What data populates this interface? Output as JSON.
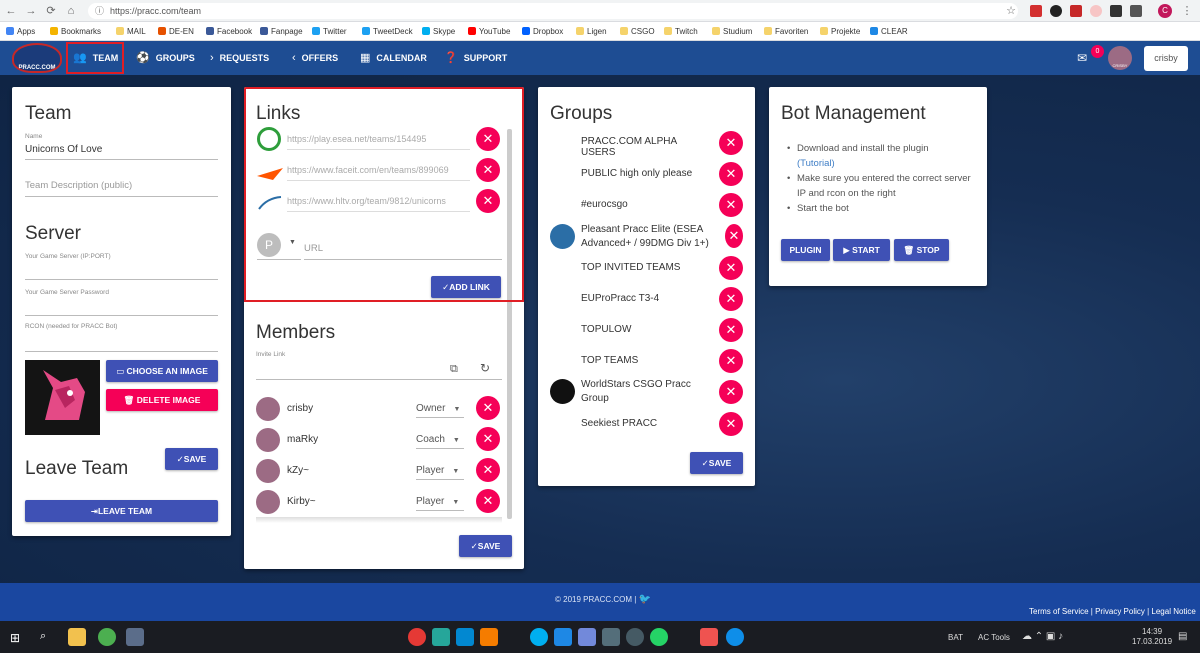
{
  "browser": {
    "url": "https://pracc.com/team",
    "bookmarks": [
      "Apps",
      "Bookmarks",
      "MAIL",
      "DE-EN",
      "Facebook",
      "Fanpage",
      "Twitter",
      "TweetDeck",
      "Skype",
      "YouTube",
      "Dropbox",
      "Ligen",
      "CSGO",
      "Twitch",
      "Studium",
      "Favoriten",
      "Projekte",
      "CLEAR"
    ],
    "profile_letter": "C"
  },
  "nav": {
    "logo": "PRACC.COM",
    "items": [
      "TEAM",
      "GROUPS",
      "REQUESTS",
      "OFFERS",
      "CALENDAR",
      "SUPPORT"
    ],
    "mail_count": "0",
    "avatar_label": "CRISBY",
    "user": "crisby"
  },
  "team": {
    "title": "Team",
    "name_label": "Name",
    "name_value": "Unicorns Of Love",
    "desc_placeholder": "Team Description (public)",
    "server_title": "Server",
    "server_ip_label": "Your Game Server (IP:PORT)",
    "server_pw_label": "Your Game Server Password",
    "rcon_label": "RCON (needed for PRACC Bot)",
    "choose_image": "CHOOSE AN IMAGE",
    "delete_image": "DELETE IMAGE",
    "save": "SAVE",
    "leave_title": "Leave Team",
    "leave_button": "LEAVE TEAM"
  },
  "links": {
    "title": "Links",
    "items": [
      {
        "url": "https://play.esea.net/teams/154495",
        "icon": "esea-icon",
        "color": "#2e9e3b"
      },
      {
        "url": "https://www.faceit.com/en/teams/899069",
        "icon": "faceit-icon",
        "color": "#ff5500"
      },
      {
        "url": "https://www.hltv.org/team/9812/unicorns",
        "icon": "hltv-icon",
        "color": "#2b6ea6"
      }
    ],
    "new_letter": "P",
    "url_placeholder": "URL",
    "add_button": "ADD LINK"
  },
  "members": {
    "title": "Members",
    "invite_label": "Invite Link",
    "list": [
      {
        "name": "crisby",
        "role": "Owner"
      },
      {
        "name": "maRky",
        "role": "Coach"
      },
      {
        "name": "kZy~",
        "role": "Player"
      },
      {
        "name": "Kirby~",
        "role": "Player"
      }
    ],
    "save": "SAVE"
  },
  "groups": {
    "title": "Groups",
    "list": [
      {
        "name": "PRACC.COM ALPHA USERS",
        "avatar": false
      },
      {
        "name": "PUBLIC high only please",
        "avatar": false
      },
      {
        "name": "#eurocsgo",
        "avatar": false
      },
      {
        "name": "Pleasant Pracc Elite (ESEA Advanced+ / 99DMG Div 1+)",
        "avatar": true
      },
      {
        "name": "TOP INVITED TEAMS",
        "avatar": false
      },
      {
        "name": "EUProPracc T3-4",
        "avatar": false
      },
      {
        "name": "TOPULOW",
        "avatar": false
      },
      {
        "name": "TOP TEAMS",
        "avatar": false
      },
      {
        "name": "WorldStars CSGO Pracc Group",
        "avatar": true
      },
      {
        "name": "Seekiest PRACC",
        "avatar": false
      }
    ],
    "save": "SAVE"
  },
  "bot": {
    "title": "Bot Management",
    "step1": "Download and install the plugin",
    "tutorial": "(Tutorial)",
    "step2": "Make sure you entered the correct server IP and rcon on the right",
    "step3": "Start the bot",
    "plugin": "PLUGIN",
    "start": "START",
    "stop": "STOP"
  },
  "footer": {
    "copyright": "© 2019 PRACC.COM |",
    "links": "Terms of Service | Privacy Policy | Legal Notice"
  },
  "taskbar": {
    "lang": "BAT",
    "tools": "AC Tools",
    "time": "14:39",
    "date": "17.03.2019"
  },
  "colors": {
    "accent": "#3f51b5",
    "danger": "#f50057",
    "nav": "#1e4d93",
    "highlight": "#e01e25"
  }
}
